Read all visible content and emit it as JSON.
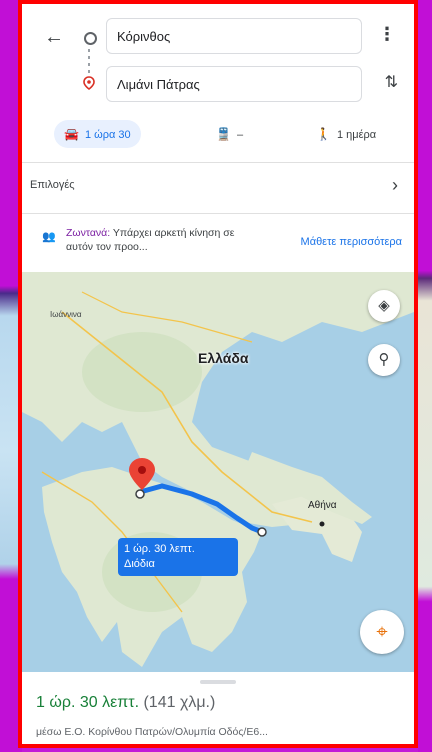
{
  "search": {
    "origin": "Κόρινθος",
    "destination": "Λιμάνι Πάτρας"
  },
  "modes": {
    "car": "1 ώρα 30",
    "transit": "–",
    "walk": "1 ημέρα"
  },
  "options": {
    "label": "Επιλογές"
  },
  "traffic": {
    "live_label": "Ζωντανά:",
    "text": "Υπάρχει αρκετή κίνηση σε αυτόν τον προο...",
    "learn_more": "Μάθετε περισσότερα"
  },
  "map": {
    "country_label": "Ελλάδα",
    "city_athens": "Αθήνα",
    "city_ioannina": "Ιωάννινα",
    "route_label_time": "1 ώρ. 30 λεπτ.",
    "route_label_tolls": "Διόδια"
  },
  "summary": {
    "duration": "1 ώρ. 30 λεπτ.",
    "distance": "(141 χλμ.)",
    "via": "μέσω Ε.Ο. Κορίνθου Πατρών/Ολυμπία Οδός/Ε6..."
  },
  "colors": {
    "accent": "#1a73e8",
    "duration_green": "#188038",
    "frame_border": "#ff0000",
    "background_magenta": "#c21ad8"
  },
  "icons": [
    "back-arrow-icon",
    "origin-circle-icon",
    "destination-pin-icon",
    "more-vert-icon",
    "swap-icon",
    "car-icon",
    "transit-icon",
    "walk-icon",
    "chevron-right-icon",
    "traffic-people-icon",
    "layers-icon",
    "search-icon",
    "my-location-icon",
    "map-marker-icon"
  ]
}
